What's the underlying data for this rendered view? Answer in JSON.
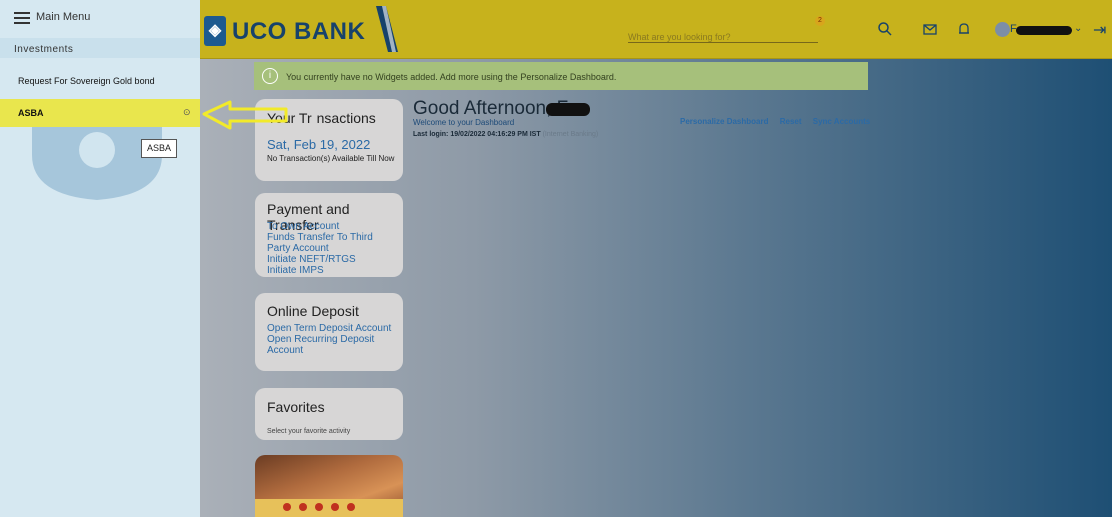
{
  "sidebar": {
    "title": "Main Menu",
    "section": "Investments",
    "items": [
      "Request For Sovereign Gold bond",
      "ASBA"
    ],
    "tooltip": "ASBA"
  },
  "header": {
    "brand": "UCO BANK",
    "search_placeholder": "What are you looking for?",
    "badge": "2",
    "user_initial": "F",
    "icons": [
      "search-icon",
      "mail-icon",
      "bell-icon",
      "logout-icon"
    ]
  },
  "banner": {
    "text": "You currently have no Widgets added. Add more using the Personalize Dashboard."
  },
  "greeting": {
    "title": "Good Afternoon, F",
    "welcome": "Welcome to your Dashboard",
    "last_login": "Last login: 19/02/2022 04:16:29 PM IST",
    "channel": "(Internet Banking)",
    "links": [
      "Personalize Dashboard",
      "Reset",
      "Sync Accounts"
    ]
  },
  "widgets": {
    "transactions": {
      "title": "Your Tr",
      "title_rest": "nsactions",
      "date": "Sat, Feb 19, 2022",
      "note": "No Transaction(s) Available Till Now"
    },
    "payment": {
      "title": "Payment and Transfer",
      "links": [
        "To Own Account",
        "Funds Transfer To Third Party Account",
        "Initiate NEFT/RTGS",
        "Initiate IMPS"
      ]
    },
    "deposit": {
      "title": "Online Deposit",
      "links": [
        "Open Term Deposit Account",
        "Open Recurring Deposit Account"
      ]
    },
    "favorites": {
      "title": "Favorites",
      "note": "Select your favorite activity"
    }
  },
  "colors": {
    "header": "#c7b21c",
    "sidebar": "#d6e8f1",
    "highlight": "#e9e64d",
    "link": "#2b6aa6",
    "brand": "#17426b"
  }
}
